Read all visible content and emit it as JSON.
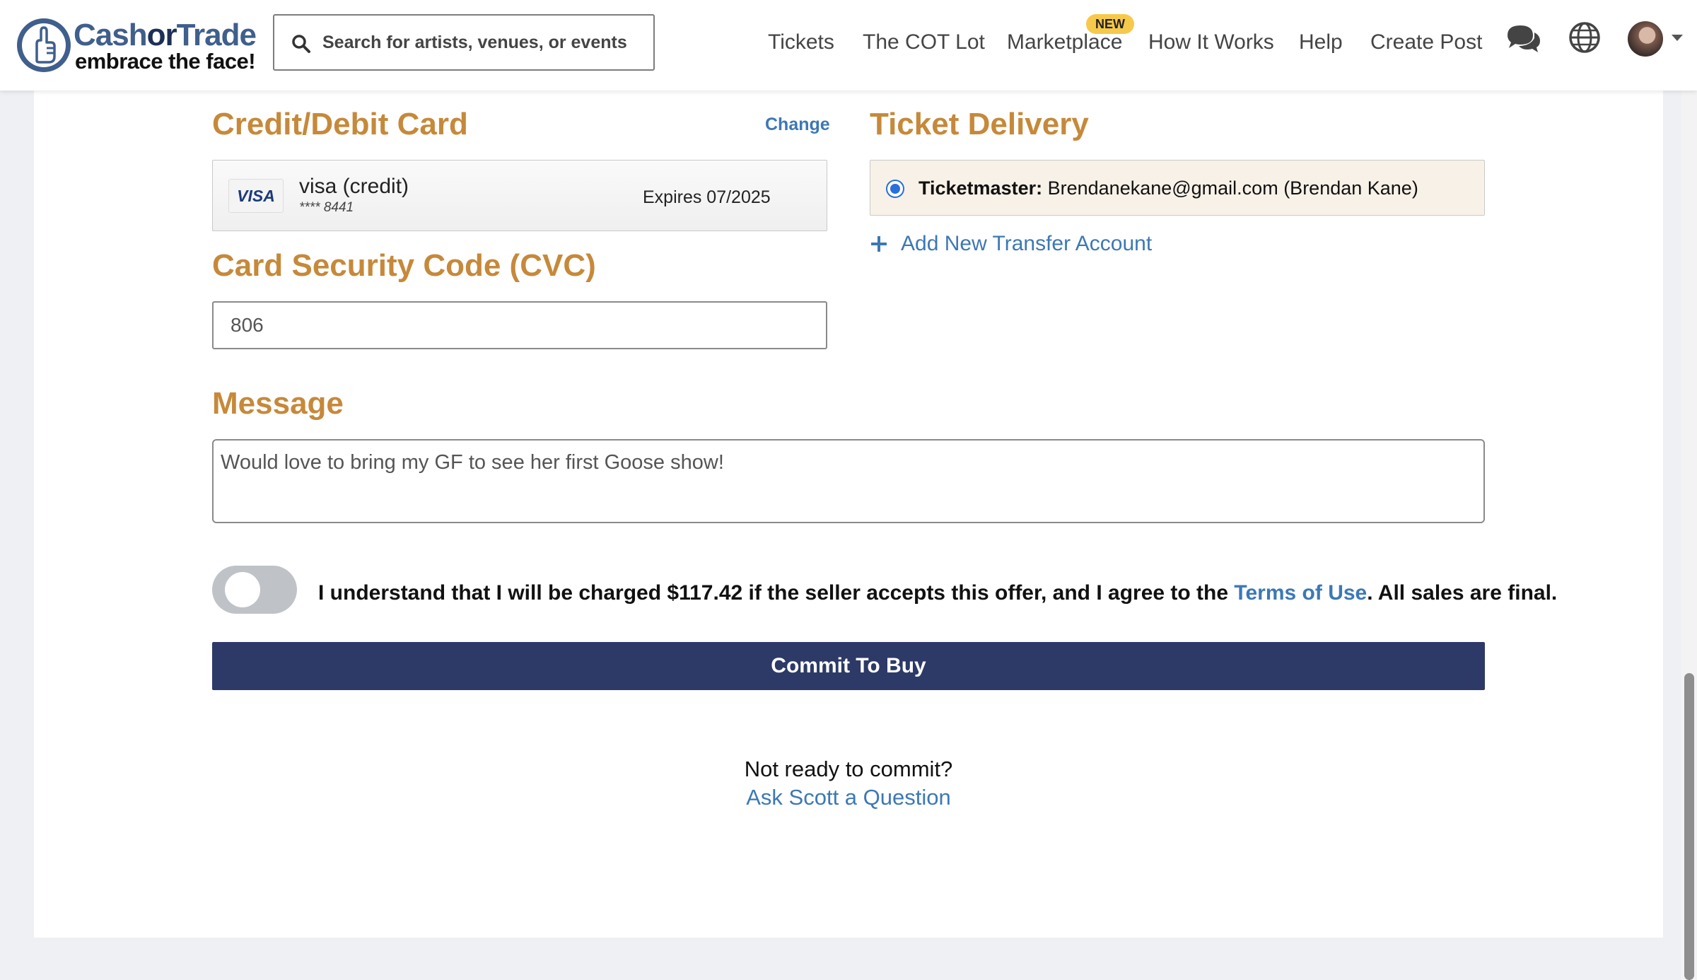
{
  "header": {
    "logo": {
      "line1_a": "Cash",
      "line1_b": "or",
      "line1_c": "Trade",
      "line2": "embrace the face!"
    },
    "search": {
      "placeholder": "Search for artists, venues, or events",
      "icon": "search-icon"
    },
    "nav": [
      {
        "label": "Tickets"
      },
      {
        "label": "The COT Lot"
      },
      {
        "label": "Marketplace",
        "badge": "NEW"
      },
      {
        "label": "How It Works"
      },
      {
        "label": "Help"
      },
      {
        "label": "Create Post"
      }
    ],
    "icons": [
      "chat-icon",
      "globe-icon",
      "avatar",
      "chevron-down-icon"
    ]
  },
  "payment": {
    "title": "Credit/Debit Card",
    "change_label": "Change",
    "card": {
      "brand": "VISA",
      "type": "visa (credit)",
      "number": "**** 8441",
      "expires": "Expires 07/2025"
    }
  },
  "cvc": {
    "title": "Card Security Code (CVC)",
    "value": "806"
  },
  "delivery": {
    "title": "Ticket Delivery",
    "method": "Ticketmaster:",
    "account": "Brendanekane@gmail.com (Brendan Kane)",
    "add_label": "Add New Transfer Account"
  },
  "message": {
    "title": "Message",
    "value": "Would love to bring my GF to see her first Goose show!"
  },
  "agreement": {
    "text_before": "I understand that I will be charged $117.42 if the seller accepts this offer, and I agree to the ",
    "link": "Terms of Use",
    "text_after": ". All sales are final.",
    "toggle_on": false
  },
  "commit_label": "Commit To Buy",
  "footer": {
    "question": "Not ready to commit?",
    "ask_link": "Ask Scott a Question"
  },
  "colors": {
    "accent_orange": "#c6893a",
    "link_blue": "#3c78b5",
    "button_navy": "#2d3a67",
    "badge_yellow": "#f6c94a"
  }
}
